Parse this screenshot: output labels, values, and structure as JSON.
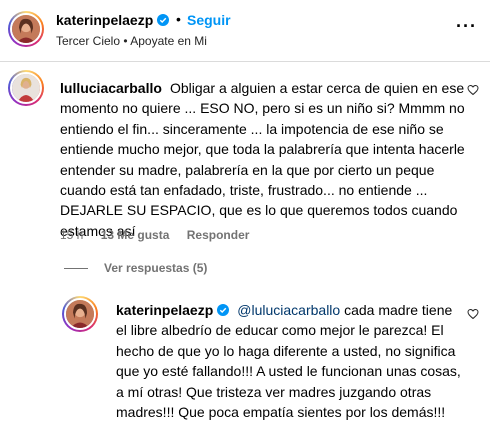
{
  "post_header": {
    "username": "katerinpelaezp",
    "dot": "•",
    "follow_label": "Seguir",
    "audio": "Tercer Cielo • Apoyate en Mi",
    "more_icon": "more-horizontal-icon"
  },
  "comment": {
    "username": "lulluciacarballo",
    "text": "Obligar a alguien a estar cerca de quien en ese momento no quiere ... ESO NO, pero si es un niño si? Mmmm no entiendo el fin... sinceramente ... la impotencia de ese niño se entiende mucho mejor, que toda la palabrería que intenta hacerle entender su madre, palabrería en la que por cierto un peque cuando está tan enfadado, triste, frustrado... no entiende ... DEJARLE SU ESPACIO, que es lo que queremos todos cuando estamos así",
    "time": "15 h",
    "likes": "13 Me gusta",
    "reply_label": "Responder",
    "view_replies": "Ver respuestas (5)"
  },
  "reply": {
    "username": "katerinpelaezp",
    "mention": "@luluciacarballo",
    "text": "cada madre tiene el libre albedrío de educar como mejor le parezca! El hecho de que yo lo haga diferente a usted, no significa que yo esté fallando!!! A usted le funcionan unas cosas, a mí otras! Que tristeza ver madres juzgando otras madres!!! Que poca empatía sientes por los demás!!!"
  },
  "colors": {
    "accent": "#0095f6",
    "muted": "#737373",
    "mention": "#00376b"
  }
}
